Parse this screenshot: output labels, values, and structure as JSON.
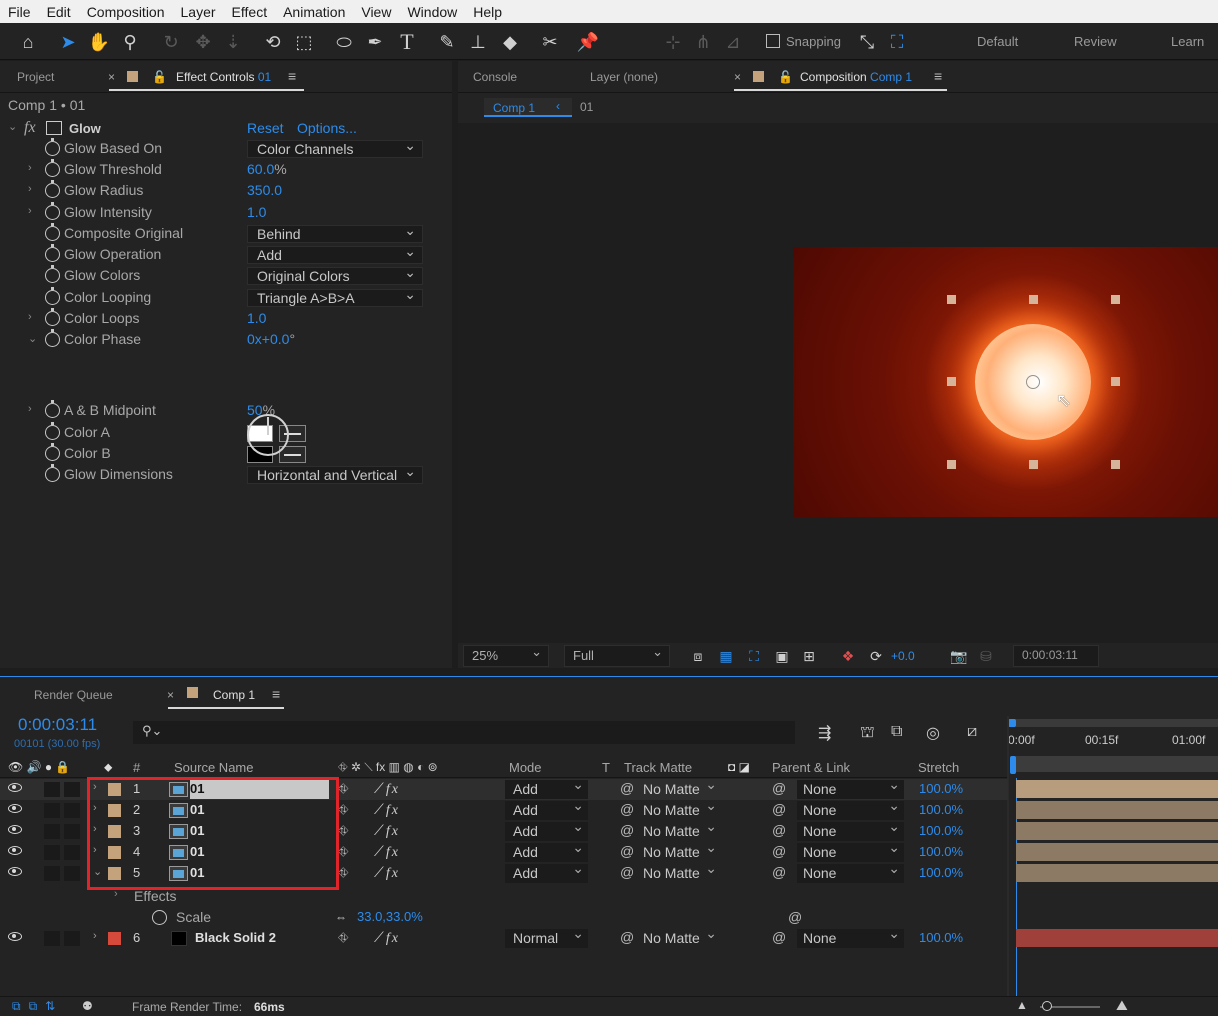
{
  "menu": [
    "File",
    "Edit",
    "Composition",
    "Layer",
    "Effect",
    "Animation",
    "View",
    "Window",
    "Help"
  ],
  "toolbar": {
    "snapping_label": "Snapping",
    "workspaces": [
      "Default",
      "Review",
      "Learn"
    ]
  },
  "left_panel": {
    "tab_project": "Project",
    "tab_effect_controls": "Effect Controls",
    "tab_effect_controls_layer": "01",
    "breadcrumb": "Comp 1 • 01",
    "effect": {
      "name": "Glow",
      "reset": "Reset",
      "options": "Options...",
      "fx": "fx"
    },
    "properties": [
      {
        "label": "Glow Based On",
        "type": "dropdown",
        "value": "Color Channels",
        "expandable": false
      },
      {
        "label": "Glow Threshold",
        "type": "value",
        "value": "60.0",
        "unit": "%",
        "expandable": true
      },
      {
        "label": "Glow Radius",
        "type": "value",
        "value": "350.0",
        "unit": "",
        "expandable": true
      },
      {
        "label": "Glow Intensity",
        "type": "value",
        "value": "1.0",
        "unit": "",
        "expandable": true
      },
      {
        "label": "Composite Original",
        "type": "dropdown",
        "value": "Behind",
        "expandable": false
      },
      {
        "label": "Glow Operation",
        "type": "dropdown",
        "value": "Add",
        "expandable": false
      },
      {
        "label": "Glow Colors",
        "type": "dropdown",
        "value": "Original Colors",
        "expandable": false
      },
      {
        "label": "Color Looping",
        "type": "dropdown",
        "value": "Triangle A>B>A",
        "expandable": false
      },
      {
        "label": "Color Loops",
        "type": "value",
        "value": "1.0",
        "unit": "",
        "expandable": true
      },
      {
        "label": "Color Phase",
        "type": "value",
        "value": "0x+0.0",
        "unit": "°",
        "expandable": true,
        "expanded": true
      },
      {
        "label": "A & B Midpoint",
        "type": "value",
        "value": "50",
        "unit": "%",
        "expandable": true
      },
      {
        "label": "Color A",
        "type": "color",
        "value": "#ffffff",
        "expandable": false
      },
      {
        "label": "Color B",
        "type": "color",
        "value": "#000000",
        "expandable": false
      },
      {
        "label": "Glow Dimensions",
        "type": "dropdown",
        "value": "Horizontal and Vertical",
        "expandable": false
      }
    ]
  },
  "comp_panel": {
    "tab_console": "Console",
    "tab_layer": "Layer (none)",
    "tab_composition": "Composition",
    "tab_composition_name": "Comp 1",
    "crumb_comp": "Comp 1",
    "crumb_layer": "01",
    "zoom": "25%",
    "resolution": "Full",
    "exposure": "+0.0",
    "timecode": "0:00:03:11",
    "colors": {
      "bg_dark": "#5a0b02",
      "bg_mid": "#8a1a08",
      "glow": "#ff6a20"
    }
  },
  "timeline": {
    "tab_render_queue": "Render Queue",
    "tab_comp": "Comp 1",
    "timecode": "0:00:03:11",
    "frame_info": "00101 (30.00 fps)",
    "search_placeholder": "",
    "columns": {
      "source_name": "Source Name",
      "hash": "#",
      "mode": "Mode",
      "t": "T",
      "track_matte": "Track Matte",
      "parent_link": "Parent & Link",
      "stretch": "Stretch"
    },
    "ruler": [
      "0:00f",
      "00:15f",
      "01:00f"
    ],
    "layers": [
      {
        "num": "1",
        "name": "01",
        "mode": "Add",
        "matte": "No Matte",
        "parent": "None",
        "stretch": "100.0%",
        "label_color": "#c4a27c",
        "selected": true
      },
      {
        "num": "2",
        "name": "01",
        "mode": "Add",
        "matte": "No Matte",
        "parent": "None",
        "stretch": "100.0%",
        "label_color": "#c4a27c"
      },
      {
        "num": "3",
        "name": "01",
        "mode": "Add",
        "matte": "No Matte",
        "parent": "None",
        "stretch": "100.0%",
        "label_color": "#c4a27c"
      },
      {
        "num": "4",
        "name": "01",
        "mode": "Add",
        "matte": "No Matte",
        "parent": "None",
        "stretch": "100.0%",
        "label_color": "#c4a27c"
      },
      {
        "num": "5",
        "name": "01",
        "mode": "Add",
        "matte": "No Matte",
        "parent": "None",
        "stretch": "100.0%",
        "label_color": "#c4a27c",
        "expanded": true
      }
    ],
    "effects_label": "Effects",
    "scale_label": "Scale",
    "scale_value": "33.0,33.0%",
    "solid_layer": {
      "num": "6",
      "name": "Black Solid 2",
      "mode": "Normal",
      "matte": "No Matte",
      "parent": "None",
      "stretch": "100.0%",
      "label_color": "#d64a3c"
    },
    "frame_render_label": "Frame Render Time:",
    "frame_render_value": "66ms",
    "highlight_color": "#e0242a"
  }
}
